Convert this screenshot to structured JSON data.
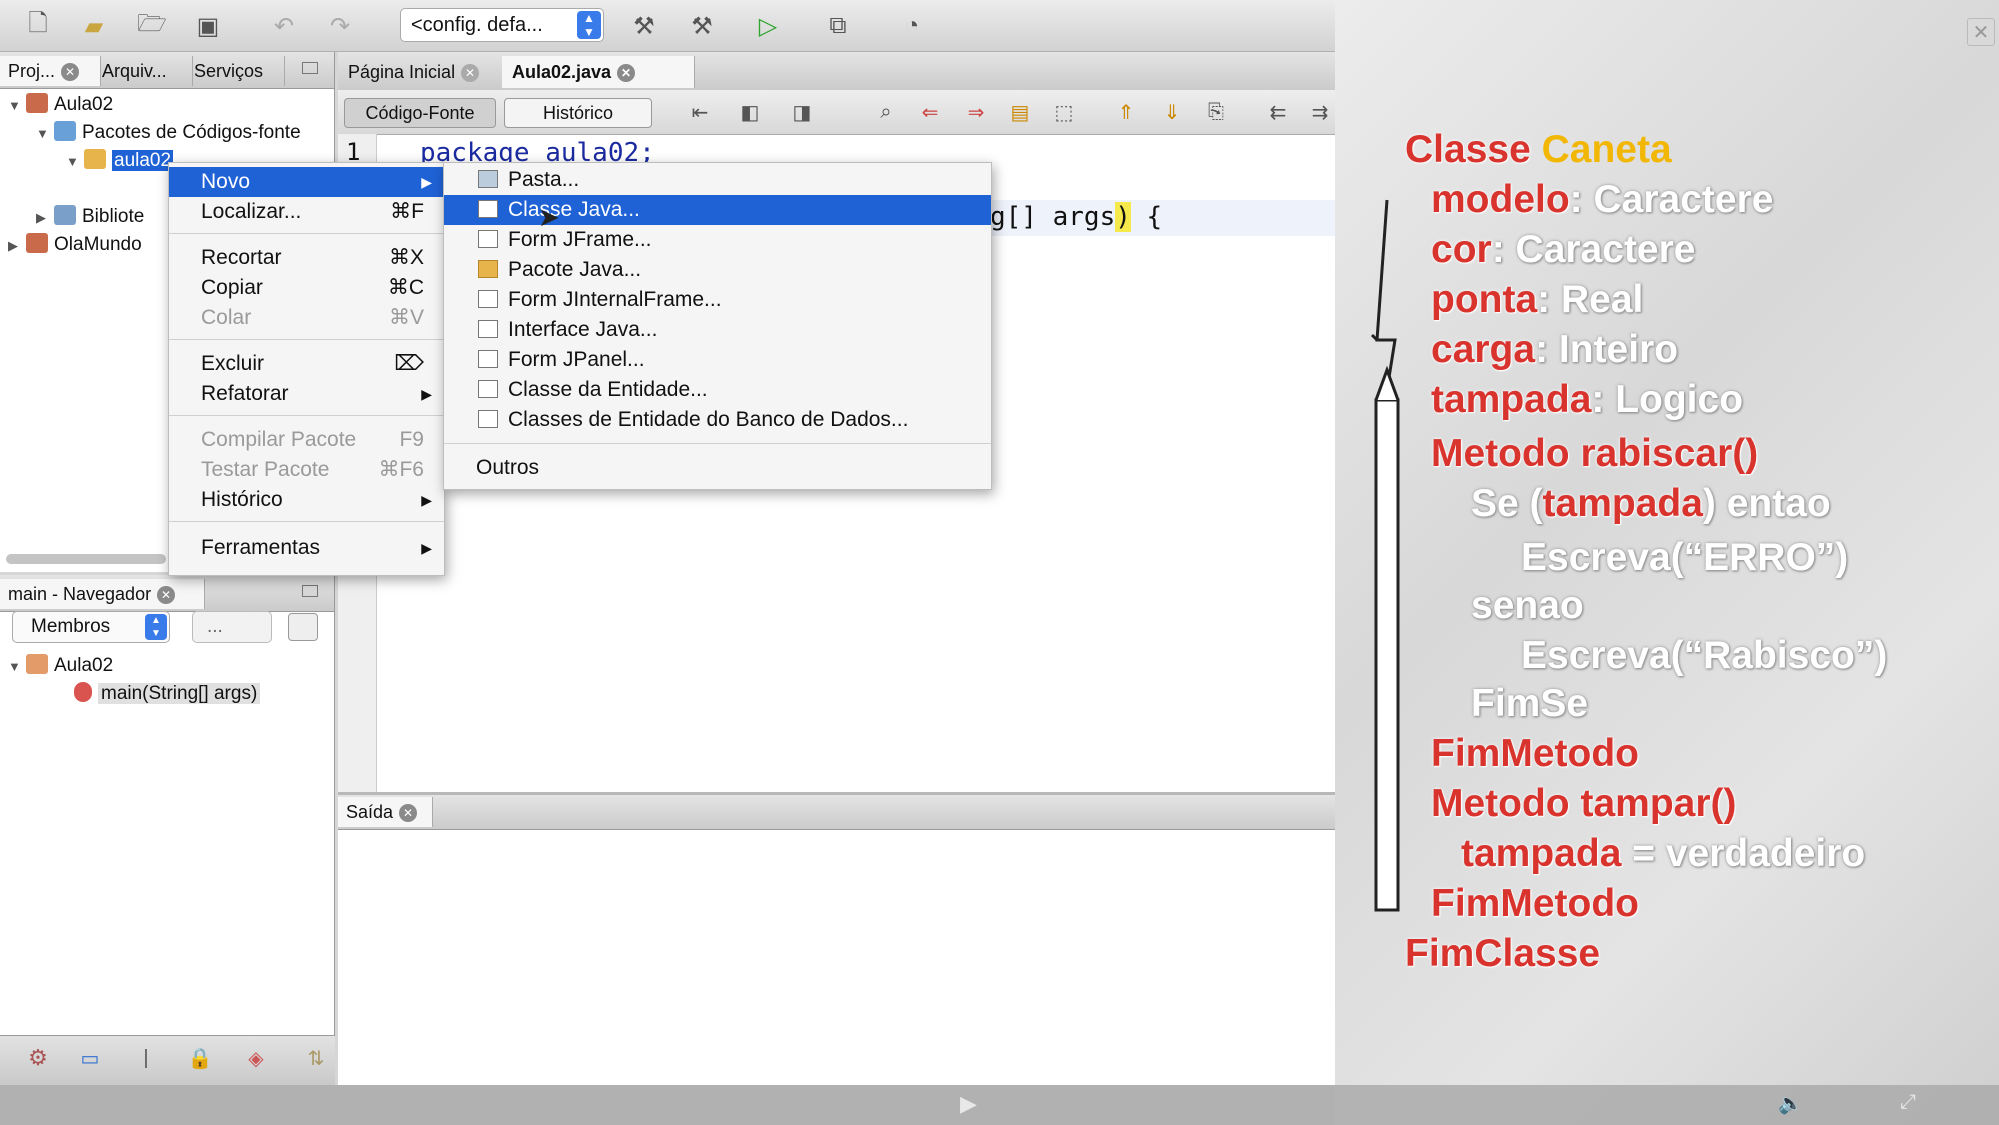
{
  "toolbar": {
    "config_value": "<config. defa...",
    "icons": [
      "new-file-icon",
      "new-project-icon",
      "open-project-icon",
      "save-all-icon",
      "undo-icon",
      "redo-icon",
      "build-icon",
      "clean-build-icon",
      "run-icon",
      "debug-icon",
      "profile-icon"
    ]
  },
  "projects_panel": {
    "tabs": [
      "Proj...",
      "Arquiv...",
      "Serviços"
    ],
    "tree": {
      "root": "Aula02",
      "packages": "Pacotes de Códigos-fonte",
      "package": "aula02",
      "libraries": "Bibliote",
      "other_project": "OlaMundo"
    }
  },
  "navigator_panel": {
    "title": "main - Navegador",
    "members_select": "Membros",
    "filter_select": "...",
    "tree_root": "Aula02",
    "tree_item": "main(String[] args)"
  },
  "editor": {
    "tabs": [
      "Página Inicial",
      "Aula02.java"
    ],
    "source_btn": "Código-Fonte",
    "history_btn": "Histórico",
    "line_number": "1",
    "line1": "package aula02;",
    "line_args": "g[] args",
    "paren": ")",
    "brace": " {"
  },
  "output": {
    "tab": "Saída"
  },
  "context_menu": {
    "items": [
      {
        "label": "Novo",
        "submenu": true,
        "selected": true
      },
      {
        "label": "Localizar...",
        "shortcut": "⌘F"
      },
      {
        "label": "Recortar",
        "shortcut": "⌘X"
      },
      {
        "label": "Copiar",
        "shortcut": "⌘C"
      },
      {
        "label": "Colar",
        "shortcut": "⌘V",
        "disabled": true
      },
      {
        "label": "Excluir",
        "shortcut": "⌦"
      },
      {
        "label": "Refatorar",
        "submenu": true
      },
      {
        "label": "Compilar Pacote",
        "shortcut": "F9",
        "disabled": true
      },
      {
        "label": "Testar Pacote",
        "shortcut": "⌘F6",
        "disabled": true
      },
      {
        "label": "Histórico",
        "submenu": true
      },
      {
        "label": "Ferramentas",
        "submenu": true
      }
    ]
  },
  "submenu": {
    "items": [
      "Pasta...",
      "Classe Java...",
      "Form JFrame...",
      "Pacote Java...",
      "Form JInternalFrame...",
      "Interface Java...",
      "Form JPanel...",
      "Classe da Entidade...",
      "Classes de Entidade do Banco de Dados...",
      "Outros"
    ]
  },
  "slide": {
    "l1a": "Classe",
    "l1b": "Caneta",
    "l2a": "modelo",
    "l2b": ": Caractere",
    "l3a": "cor",
    "l3b": ": Caractere",
    "l4a": "ponta",
    "l4b": ": Real",
    "l5a": "carga",
    "l5b": ": Inteiro",
    "l6a": "tampada",
    "l6b": ": Logico",
    "l7a": "Metodo",
    "l7b": "rabiscar()",
    "l8a": "Se (",
    "l8b": "tampada",
    "l8c": ") entao",
    "l9": "Escreva(“ERRO”)",
    "l10": "senao",
    "l11": "Escreva(“Rabisco”)",
    "l12": "FimSe",
    "l13": "FimMetodo",
    "l14a": "Metodo",
    "l14b": "tampar()",
    "l15a": "tampada",
    "l15b": " = verdadeiro",
    "l16": "FimMetodo",
    "l17": "FimClasse"
  },
  "colors": {
    "accent": "#1f62d6",
    "slide_red": "#d9332e",
    "slide_gold": "#f2b705"
  }
}
